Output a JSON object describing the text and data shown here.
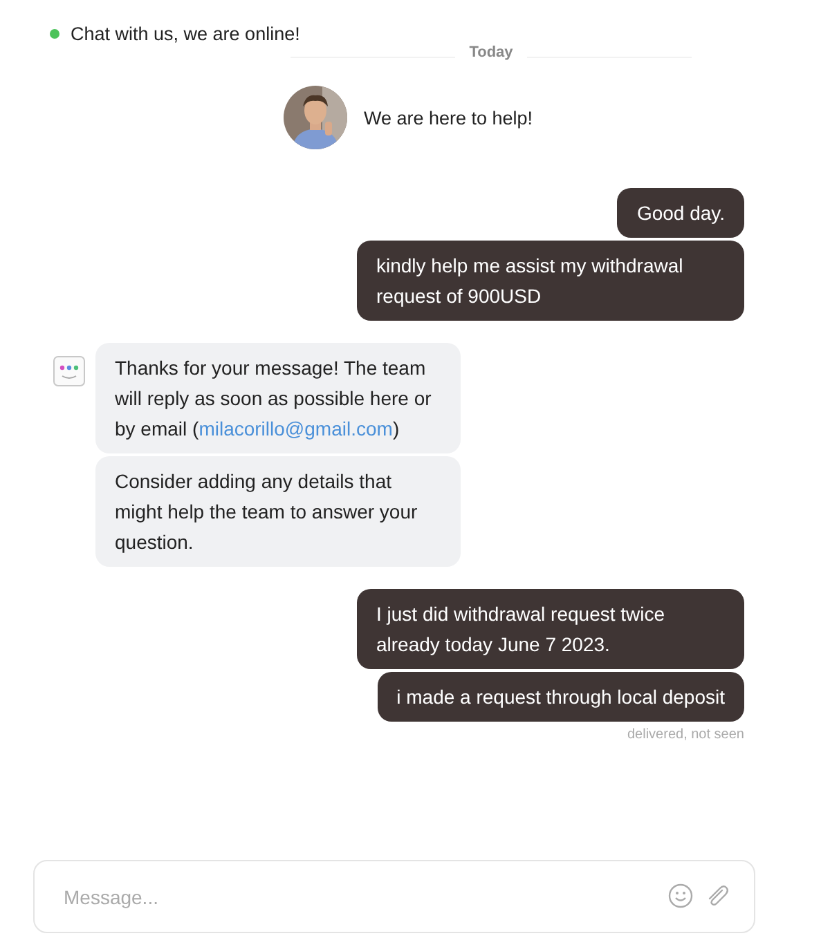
{
  "header": {
    "status": "Chat with us, we are online!",
    "online": true
  },
  "divider": "Today",
  "agent": {
    "greeting": "We are here to help!"
  },
  "groups": [
    {
      "kind": "user",
      "bubbles": [
        {
          "text": "Good day."
        },
        {
          "text": "kindly help me assist my withdrawal request of 900USD"
        }
      ]
    },
    {
      "kind": "bot",
      "bubbles": [
        {
          "text": "Thanks for your message! The team will reply as soon as possible here or by email (",
          "link": "milacorillo@gmail.com",
          "after": ")"
        },
        {
          "text": "Consider adding any details that might help the team to answer your question."
        }
      ]
    },
    {
      "kind": "user",
      "bubbles": [
        {
          "text": "I just did withdrawal request twice already today June 7 2023."
        },
        {
          "text": "i made a request through local deposit"
        }
      ],
      "status": "delivered, not seen"
    }
  ],
  "composer": {
    "placeholder": "Message..."
  }
}
